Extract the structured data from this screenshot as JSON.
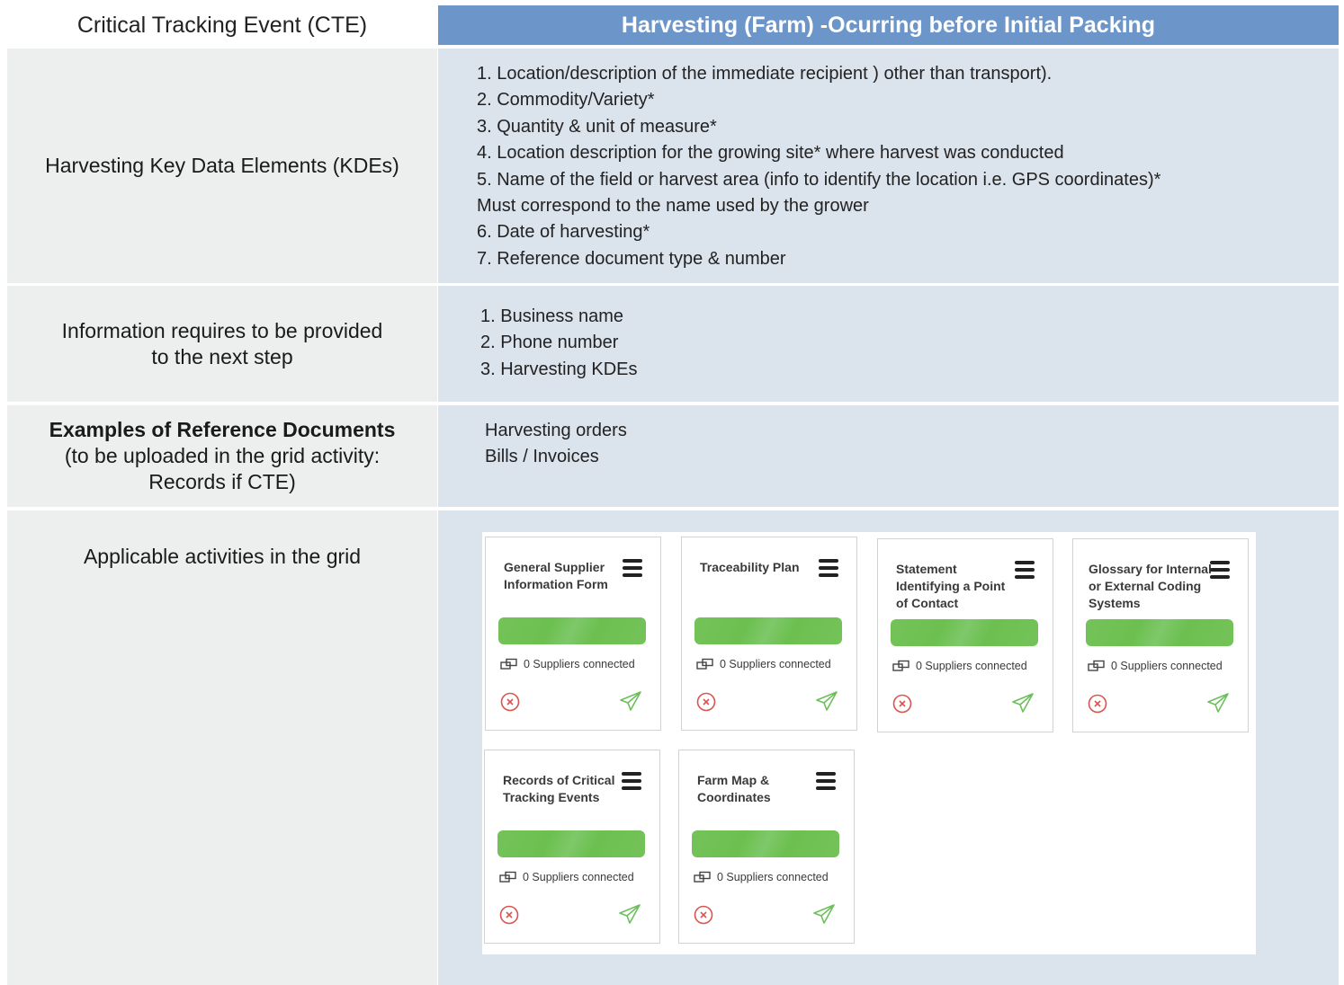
{
  "header": {
    "cte_label": "Critical Tracking Event (CTE)",
    "title": "Harvesting (Farm) -Ocurring before Initial Packing"
  },
  "rows": {
    "kdes": {
      "label": "Harvesting Key Data Elements (KDEs)",
      "items": [
        "1. Location/description of the immediate recipient ) other than transport).",
        "2. Commodity/Variety*",
        "3. Quantity & unit of measure*",
        "4. Location description for the growing site* where harvest was conducted",
        "5. Name of the field or harvest area (info to identify the location i.e. GPS coordinates)*",
        "Must correspond to the name used by the grower",
        "6. Date of harvesting*",
        "7. Reference document type & number"
      ]
    },
    "next_step": {
      "label_line1": "Information requires to be provided",
      "label_line2": "to the next step",
      "items": [
        "1. Business name",
        "2. Phone number",
        "3. Harvesting KDEs"
      ]
    },
    "reference_docs": {
      "label_bold": "Examples of Reference Documents",
      "label_line2": "(to be uploaded in the grid activity:",
      "label_line3": "Records if CTE)",
      "items": [
        "Harvesting orders",
        "Bills / Invoices"
      ]
    },
    "activities": {
      "label": "Applicable activities in the grid",
      "cards": [
        {
          "title": "General Supplier Information Form",
          "suppliers": "0 Suppliers connected"
        },
        {
          "title": "Traceability Plan",
          "suppliers": "0 Suppliers connected"
        },
        {
          "title": "Statement Identifying a Point of Contact",
          "suppliers": "0 Suppliers connected"
        },
        {
          "title": "Glossary for Internal or External Coding Systems",
          "suppliers": "0 Suppliers connected"
        },
        {
          "title": "Records of Critical Tracking Events",
          "suppliers": "0 Suppliers connected"
        },
        {
          "title": "Farm Map & Coordinates",
          "suppliers": "0 Suppliers connected"
        }
      ]
    }
  },
  "colors": {
    "header_blue": "#6c96c9",
    "left_bg": "#edefef",
    "right_bg": "#dbe3ed",
    "progress_green": "#6cc04f",
    "remove_red": "#d9534f",
    "send_green": "#6cbf5a"
  }
}
